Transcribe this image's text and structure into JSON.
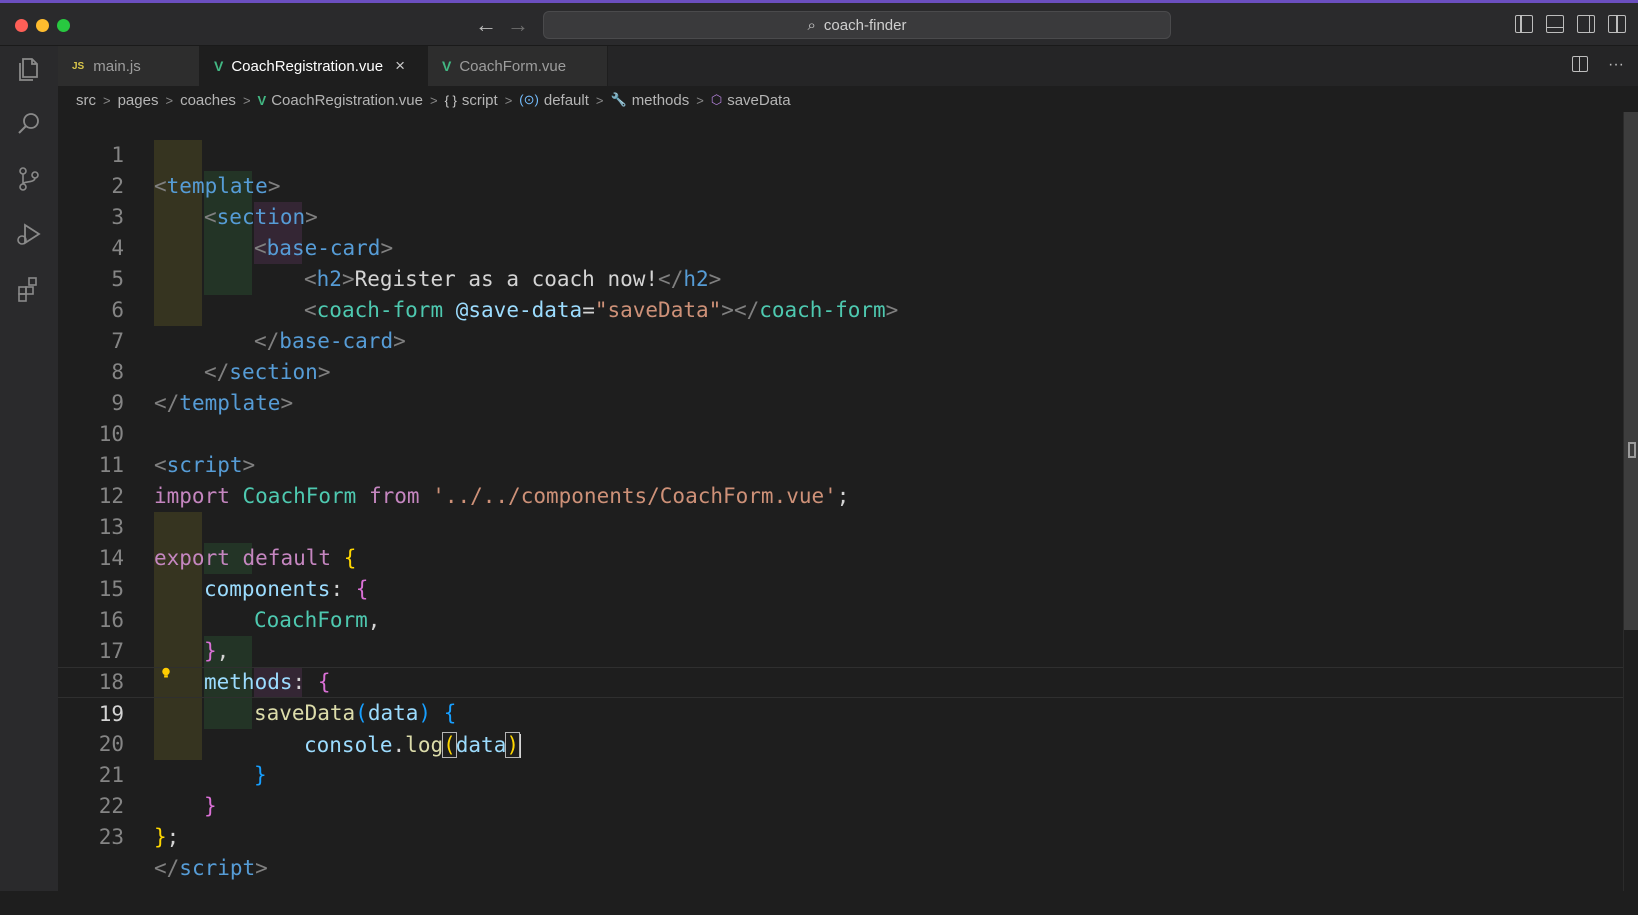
{
  "window": {
    "title": "coach-finder",
    "nav_back": "←",
    "nav_forward": "→",
    "search_glyph": "⌕",
    "traffic_colors": [
      "#fe5f57",
      "#febc2e",
      "#28c840"
    ]
  },
  "activity_bar": {
    "items": [
      "files-icon",
      "search-icon",
      "source-control-icon",
      "run-debug-icon",
      "extensions-icon"
    ]
  },
  "tabs": [
    {
      "label": "main.js",
      "icon": "JS",
      "active": false
    },
    {
      "label": "CoachRegistration.vue",
      "icon": "V",
      "active": true,
      "close": "×"
    },
    {
      "label": "CoachForm.vue",
      "icon": "V",
      "active": false
    }
  ],
  "tab_actions": {
    "more": "···"
  },
  "breadcrumb": {
    "src": "src",
    "pages": "pages",
    "coaches": "coaches",
    "file": "CoachRegistration.vue",
    "script": "script",
    "script_icon": "{ }",
    "default": "default",
    "default_icon": "(⊙)",
    "methods": "methods",
    "methods_icon": "🔧",
    "saveData": "saveData",
    "saveData_icon": "⬡",
    "sep": ">",
    "vue_icon": "V"
  },
  "editor": {
    "current_line": 19,
    "line_numbers": [
      "1",
      "2",
      "3",
      "4",
      "5",
      "6",
      "7",
      "8",
      "9",
      "10",
      "11",
      "12",
      "13",
      "14",
      "15",
      "16",
      "17",
      "18",
      "19",
      "20",
      "21",
      "22",
      "23"
    ],
    "lines": {
      "l1": {
        "lt": "<",
        "name": "template",
        "gt": ">"
      },
      "l2": {
        "lt": "<",
        "name": "section",
        "gt": ">"
      },
      "l3": {
        "lt": "<",
        "name": "base-card",
        "gt": ">"
      },
      "l4": {
        "lt": "<",
        "name": "h2",
        "gt": ">",
        "text": "Register as a coach now!",
        "lt2": "</",
        "name2": "h2",
        "gt2": ">"
      },
      "l5": {
        "lt": "<",
        "name": "coach-form",
        "attr": "@save-data",
        "eq": "=",
        "value": "\"saveData\"",
        "gt": ">",
        "lt2": "</",
        "name2": "coach-form",
        "gt2": ">"
      },
      "l6": {
        "lt": "</",
        "name": "base-card",
        "gt": ">"
      },
      "l7": {
        "lt": "</",
        "name": "section",
        "gt": ">"
      },
      "l8": {
        "lt": "</",
        "name": "template",
        "gt": ">"
      },
      "l10": {
        "lt": "<",
        "name": "script",
        "gt": ">"
      },
      "l11": {
        "kw": "import",
        "cls": "CoachForm",
        "from": "from",
        "str": "'../../components/CoachForm.vue'",
        "semi": ";"
      },
      "l13": {
        "kw": "export",
        "kw2": "default",
        "brace": "{"
      },
      "l14": {
        "prop": "components",
        "colon": ":",
        "brace": "{"
      },
      "l15": {
        "cls": "CoachForm",
        "comma": ","
      },
      "l16": {
        "brace": "}",
        "comma": ","
      },
      "l17": {
        "prop": "methods",
        "colon": ":",
        "brace": "{"
      },
      "l18": {
        "fn": "saveData",
        "po": "(",
        "param": "data",
        "pc": ")",
        "brace": "{"
      },
      "l19": {
        "obj": "console",
        "dot": ".",
        "fn": "log",
        "po": "(",
        "param": "data",
        "pc": ")"
      },
      "l20": {
        "brace": "}"
      },
      "l21": {
        "brace": "}"
      },
      "l22": {
        "brace": "}",
        "semi": ";"
      },
      "l23": {
        "lt": "</",
        "name": "script",
        "gt": ">"
      }
    }
  },
  "colors": {
    "tag_name": "#569cd6",
    "component_tag": "#4ec9b0",
    "string": "#ce9178",
    "keyword": "#c586c0",
    "function": "#dcdcaa",
    "variable": "#9cdcfe",
    "bracket_1": "#ffd700",
    "bracket_2": "#da70d6",
    "bracket_3": "#179fff",
    "vue_green": "#42b883"
  },
  "gutter": {
    "lightbulb": "lightbulb-icon"
  }
}
